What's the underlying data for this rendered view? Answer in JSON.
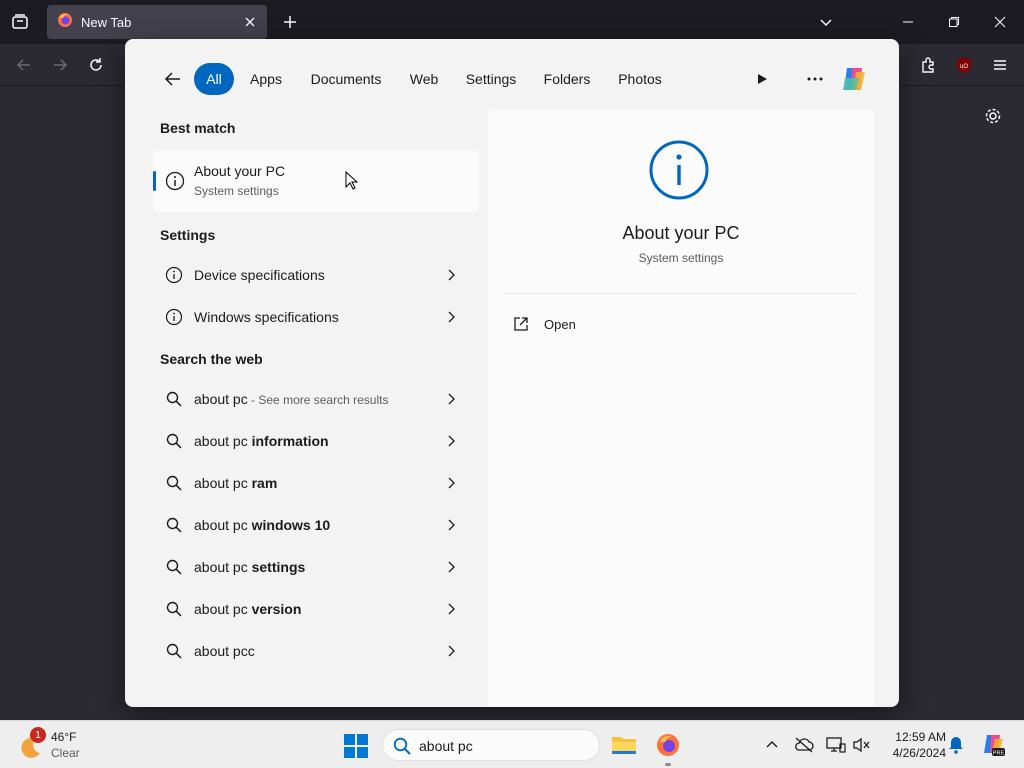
{
  "browser": {
    "tab_title": "New Tab"
  },
  "search": {
    "filters": [
      {
        "label": "All",
        "active": true
      },
      {
        "label": "Apps",
        "active": false
      },
      {
        "label": "Documents",
        "active": false
      },
      {
        "label": "Web",
        "active": false
      },
      {
        "label": "Settings",
        "active": false
      },
      {
        "label": "Folders",
        "active": false
      },
      {
        "label": "Photos",
        "active": false
      }
    ],
    "best_match_heading": "Best match",
    "best_match": {
      "title": "About your PC",
      "subtitle": "System settings"
    },
    "settings_heading": "Settings",
    "settings_items": [
      "Device specifications",
      "Windows specifications"
    ],
    "web_heading": "Search the web",
    "web_items": [
      {
        "prefix": "about pc",
        "bold": "",
        "hint": " - See more search results"
      },
      {
        "prefix": "about pc ",
        "bold": "information",
        "hint": ""
      },
      {
        "prefix": "about pc ",
        "bold": "ram",
        "hint": ""
      },
      {
        "prefix": "about pc ",
        "bold": "windows 10",
        "hint": ""
      },
      {
        "prefix": "about pc ",
        "bold": "settings",
        "hint": ""
      },
      {
        "prefix": "about pc ",
        "bold": "version",
        "hint": ""
      },
      {
        "prefix": "about pc",
        "bold": "c",
        "hint": ""
      }
    ],
    "detail": {
      "title": "About your PC",
      "subtitle": "System settings",
      "open_label": "Open"
    }
  },
  "taskbar": {
    "weather_temp": "46°F",
    "weather_cond": "Clear",
    "weather_badge": "1",
    "search_value": "about pc",
    "clock_time": "12:59 AM",
    "clock_date": "4/26/2024"
  },
  "colors": {
    "accent": "#0067c0",
    "panel_bg": "#f3f3f3",
    "browser_bg": "#2b2a33"
  }
}
